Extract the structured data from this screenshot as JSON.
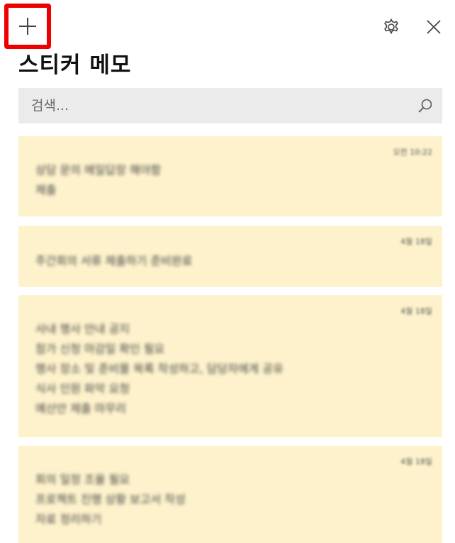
{
  "app": {
    "title": "스티커 메모"
  },
  "toolbar": {
    "add_icon": "plus-icon",
    "settings_icon": "gear-icon",
    "close_icon": "close-icon",
    "highlight_color": "#ee0000"
  },
  "search": {
    "placeholder": "검색...",
    "value": "",
    "icon": "search-icon"
  },
  "colors": {
    "note_background": "#fdf2cc",
    "search_background": "#ebebeb"
  },
  "notes": [
    {
      "date": "오전 10:22",
      "lines": [
        "상담 문의 메일답장 해야함",
        "제출"
      ]
    },
    {
      "date": "4월 18일",
      "lines": [
        "주간회의 서류 제출하기 준비완료"
      ]
    },
    {
      "date": "4월 18일",
      "lines": [
        "사내 행사 안내 공지",
        "참가 신청 마감일 확인 필요",
        "행사 장소 및 준비물 목록 작성하고, 담당자에게 공유",
        "식사 인원 파악 요청",
        "예산안 제출 마무리"
      ]
    },
    {
      "date": "4월 18일",
      "lines": [
        "회의 일정 조율 필요",
        "프로젝트 진행 상황 보고서 작성",
        "자료 정리하기"
      ]
    }
  ]
}
